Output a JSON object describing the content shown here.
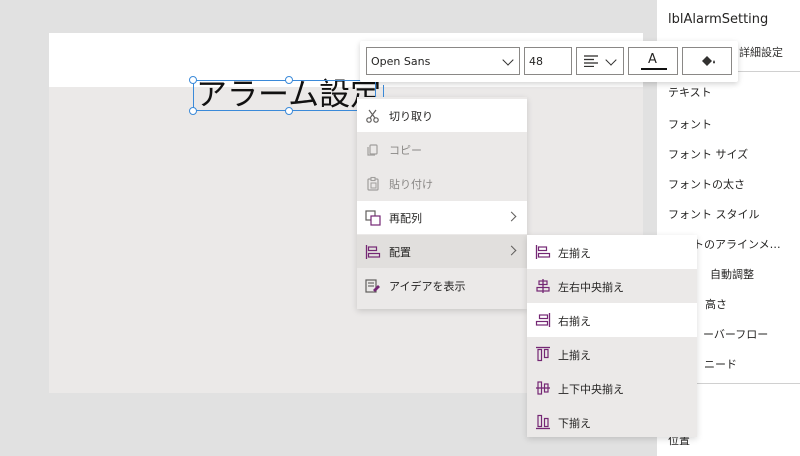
{
  "label": {
    "text": "アラーム設定"
  },
  "properties_panel": {
    "control_name": "lblAlarmSetting",
    "advanced_tab": "詳細設定",
    "items": [
      "テキスト",
      "フォント",
      "フォント サイズ",
      "フォントの太さ",
      "フォント スタイル",
      "ストのアラインメ…",
      "自動調整",
      "高さ",
      "ーバーフロー",
      "ニード",
      "位置"
    ]
  },
  "toolbar": {
    "font_family": "Open Sans",
    "font_size": "48",
    "text_color_label": "A",
    "icons": [
      "align-left-icon",
      "chevron-down-icon",
      "font-color-icon",
      "fill-bucket-icon"
    ]
  },
  "context_menu": {
    "items": [
      {
        "label": "切り取り",
        "icon": "scissors-icon"
      },
      {
        "label": "コピー",
        "icon": "copy-icon"
      },
      {
        "label": "貼り付け",
        "icon": "paste-icon"
      },
      {
        "label": "再配列",
        "icon": "reorder-icon"
      },
      {
        "label": "配置",
        "icon": "align-icon"
      },
      {
        "label": "アイデアを表示",
        "icon": "ideas-icon"
      }
    ]
  },
  "align_submenu": {
    "items": [
      {
        "label": "左揃え",
        "icon": "align-left-icon"
      },
      {
        "label": "左右中央揃え",
        "icon": "align-center-horizontal-icon"
      },
      {
        "label": "右揃え",
        "icon": "align-right-icon"
      },
      {
        "label": "上揃え",
        "icon": "align-top-icon"
      },
      {
        "label": "上下中央揃え",
        "icon": "align-middle-vertical-icon"
      },
      {
        "label": "下揃え",
        "icon": "align-bottom-icon"
      }
    ]
  },
  "colors": {
    "accent": "#742774",
    "selection": "#3b8ad9",
    "menu_bg": "#ebe9e8"
  }
}
